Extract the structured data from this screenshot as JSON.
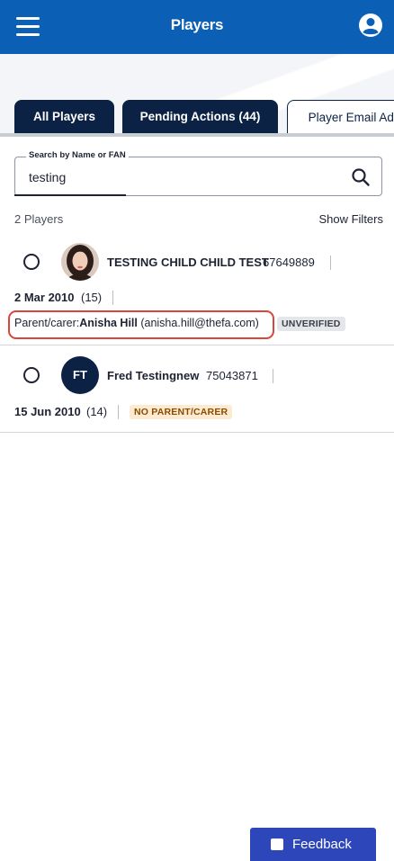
{
  "appbar": {
    "title": "Players",
    "menu_icon": "hamburger-icon",
    "account_icon": "account-circle-icon"
  },
  "tabs": [
    {
      "label": "All Players",
      "active": true
    },
    {
      "label": "Pending Actions (44)",
      "active": true
    },
    {
      "label": "Player Email Add",
      "active": false
    }
  ],
  "search": {
    "legend": "Search by Name or FAN",
    "value": "testing",
    "icon": "search-icon"
  },
  "list": {
    "count": "2 Players",
    "show_filters": "Show Filters",
    "players": [
      {
        "name": "TESTING CHILD CHILD TEST",
        "fan": "67649889",
        "dob": "2 Mar 2010",
        "age": "(15)",
        "parent_prefix": "Parent/carer:",
        "parent_name": "Anisha Hill",
        "parent_email": "(anisha.hill@thefa.com)",
        "status": "UNVERIFIED"
      },
      {
        "initials": "FT",
        "name": "Fred Testingnew",
        "fan": "75043871",
        "dob": "15 Jun 2010",
        "age": "(14)",
        "status": "NO PARENT/CARER"
      }
    ]
  },
  "feedback": {
    "label": "Feedback",
    "icon": "feedback-icon"
  },
  "colors": {
    "appbar": "#0b5fb5",
    "tab_dark": "#0c2245",
    "highlight": "#d9463a",
    "feedback": "#2d46b9"
  }
}
